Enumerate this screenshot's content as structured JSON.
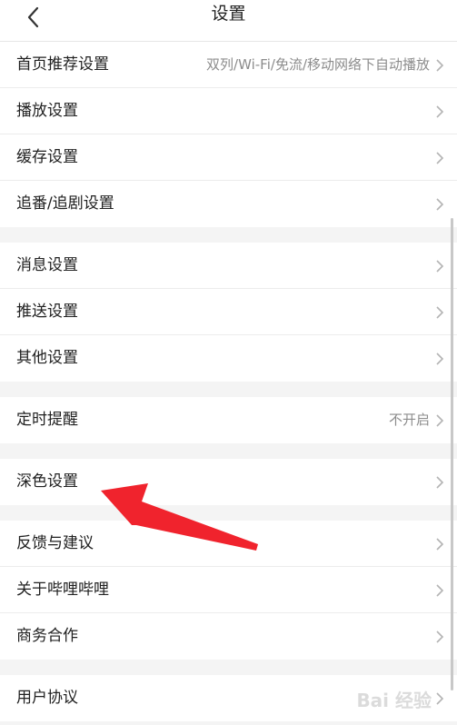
{
  "header": {
    "title": "设置",
    "back_icon": "chevron-left-icon"
  },
  "groups": [
    [
      {
        "label": "首页推荐设置",
        "value": "双列/Wi-Fi/免流/移动网络下自动播放"
      },
      {
        "label": "播放设置",
        "value": ""
      },
      {
        "label": "缓存设置",
        "value": ""
      },
      {
        "label": "追番/追剧设置",
        "value": ""
      }
    ],
    [
      {
        "label": "消息设置",
        "value": ""
      },
      {
        "label": "推送设置",
        "value": ""
      },
      {
        "label": "其他设置",
        "value": ""
      }
    ],
    [
      {
        "label": "定时提醒",
        "value": "不开启"
      }
    ],
    [
      {
        "label": "深色设置",
        "value": ""
      }
    ],
    [
      {
        "label": "反馈与建议",
        "value": ""
      },
      {
        "label": "关于哔哩哔哩",
        "value": ""
      },
      {
        "label": "商务合作",
        "value": ""
      }
    ],
    [
      {
        "label": "用户协议",
        "value": ""
      }
    ]
  ],
  "watermark": {
    "text": "Bai 经验"
  },
  "colors": {
    "annotation_arrow": "#f0232d",
    "chevron": "#b3b3b3",
    "text": "#212121",
    "secondary": "#8c8c8c"
  }
}
